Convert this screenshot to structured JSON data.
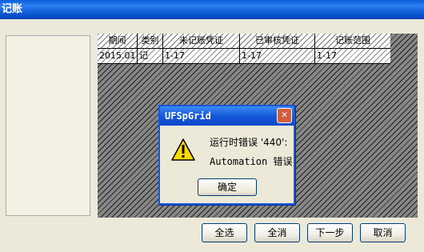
{
  "window": {
    "title": "记账"
  },
  "grid": {
    "columns": [
      "期间",
      "类别",
      "未记账凭证",
      "已审核凭证",
      "记账范围"
    ],
    "rows": [
      [
        "2015.01",
        "记",
        "1-17",
        "1-17",
        "1-17"
      ]
    ]
  },
  "dialog": {
    "title": "UFSpGrid",
    "line1": "运行时错误 '440':",
    "line2": "Automation 错误",
    "ok_label": "确定",
    "icon": "warning-icon"
  },
  "buttons": {
    "select_all": "全选",
    "deselect_all": "全消",
    "next": "下一步",
    "cancel": "取消"
  },
  "colors": {
    "title_blue": "#0a5fd8",
    "close_red": "#d35c3f",
    "warning_yellow": "#ffd800"
  }
}
